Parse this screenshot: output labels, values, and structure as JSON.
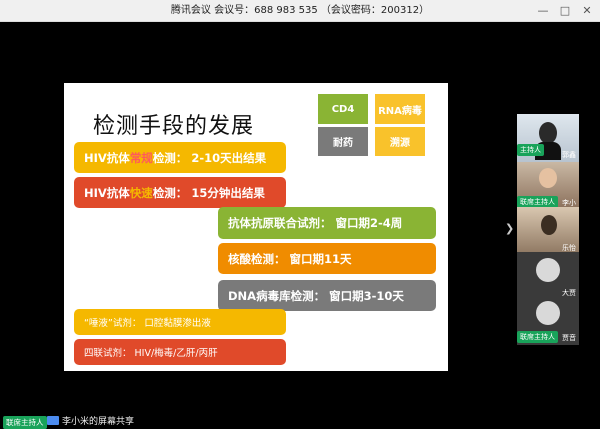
{
  "titlebar": {
    "text": "腾讯会议  会议号：688 983 535 （会议密码：200312）",
    "minimize": "—",
    "maximize": "□",
    "close": "✕"
  },
  "slide": {
    "title": "检测手段的发展",
    "tags": [
      "CD4",
      "RNA病毒",
      "耐药",
      "溯源"
    ],
    "rows": [
      {
        "pre": "HIV抗体",
        "hl": "常规",
        "post": "检测：  2-10天出结果"
      },
      {
        "pre": "HIV抗体",
        "hl": "快速",
        "post": "检测：  15分钟出结果"
      },
      {
        "text": "抗体抗原联合试剂：  窗口期2-4周"
      },
      {
        "text": "核酸检测：  窗口期11天"
      },
      {
        "text": "DNA病毒库检测：  窗口期3-10天"
      },
      {
        "text": "“唾液”试剂：  口腔黏膜渗出液"
      },
      {
        "text": "四联试剂：  HIV/梅毒/乙肝/丙肝"
      }
    ]
  },
  "participants": [
    {
      "name": "郭鑫",
      "host": "主持人"
    },
    {
      "name": "李小",
      "host": "联席主持人"
    },
    {
      "name": "乐怡",
      "host": ""
    },
    {
      "name": "大贾",
      "host": ""
    },
    {
      "name": "贾音",
      "host": "联席主持人"
    }
  ],
  "bottom": {
    "host_badge": "联席主持人",
    "share_text": "李小米的屏幕共享"
  },
  "colors": {
    "yellow": "#f5b800",
    "red": "#e04a2a",
    "green": "#8ab434",
    "orange": "#f08c00",
    "gray": "#7a7a7a",
    "tag_yellow": "#f9c22b"
  }
}
